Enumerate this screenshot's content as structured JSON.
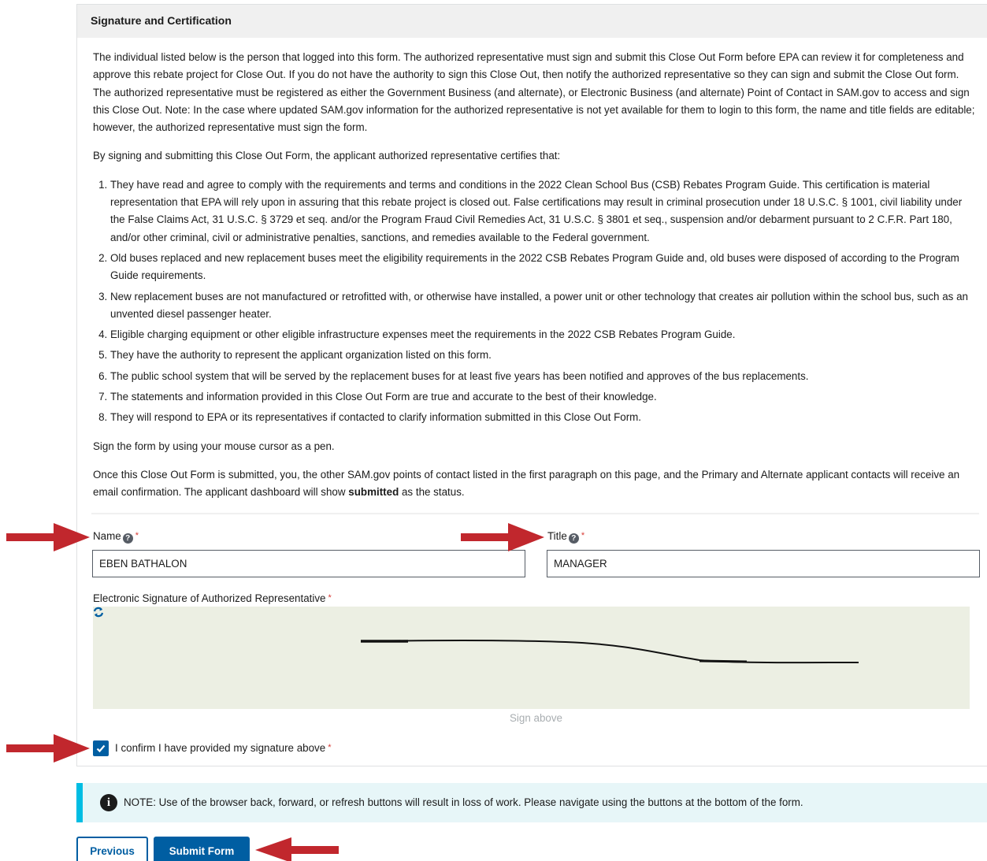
{
  "panel": {
    "title": "Signature and Certification",
    "intro": "The individual listed below is the person that logged into this form. The authorized representative must sign and submit this Close Out Form before EPA can review it for completeness and approve this rebate project for Close Out. If you do not have the authority to sign this Close Out, then notify the authorized representative so they can sign and submit the Close Out form. The authorized representative must be registered as either the Government Business (and alternate), or Electronic Business (and alternate) Point of Contact in SAM.gov to access and sign this Close Out. Note: In the case where updated SAM.gov information for the authorized representative is not yet available for them to login to this form, the name and title fields are editable; however, the authorized representative must sign the form.",
    "certify_lead": "By signing and submitting this Close Out Form, the applicant authorized representative certifies that:",
    "certifications": [
      "They have read and agree to comply with the requirements and terms and conditions in the 2022 Clean School Bus (CSB) Rebates Program Guide. This certification is material representation that EPA will rely upon in assuring that this rebate project is closed out. False certifications may result in criminal prosecution under 18 U.S.C. § 1001, civil liability under the False Claims Act, 31 U.S.C. § 3729 et seq. and/or the Program Fraud Civil Remedies Act, 31 U.S.C. § 3801 et seq., suspension and/or debarment pursuant to 2 C.F.R. Part 180, and/or other criminal, civil or administrative penalties, sanctions, and remedies available to the Federal government.",
      "Old buses replaced and new replacement buses meet the eligibility requirements in the 2022 CSB Rebates Program Guide and, old buses were disposed of according to the Program Guide requirements.",
      "New replacement buses are not manufactured or retrofitted with, or otherwise have installed, a power unit or other technology that creates air pollution within the school bus, such as an unvented diesel passenger heater.",
      "Eligible charging equipment or other eligible infrastructure expenses meet the requirements in the 2022 CSB Rebates Program Guide.",
      "They have the authority to represent the applicant organization listed on this form.",
      "The public school system that will be served by the replacement buses for at least five years has been notified and approves of the bus replacements.",
      "The statements and information provided in this Close Out Form are true and accurate to the best of their knowledge.",
      "They will respond to EPA or its representatives if contacted to clarify information submitted in this Close Out Form."
    ],
    "sign_instruction": "Sign the form by using your mouse cursor as a pen.",
    "confirm_text_a": "Once this Close Out Form is submitted, you, the other SAM.gov points of contact listed in the first paragraph on this page, and the Primary and Alternate applicant contacts will receive an email confirmation. The applicant dashboard will show ",
    "confirm_text_bold": "submitted",
    "confirm_text_b": " as the status."
  },
  "fields": {
    "name_label": "Name",
    "name_value": "EBEN BATHALON",
    "title_label": "Title",
    "title_value": "MANAGER",
    "help_glyph": "?",
    "required_mark": "*",
    "signature_label": "Electronic Signature of Authorized Representative",
    "signature_hint": "Sign above",
    "confirm_checkbox_label": "I confirm I have provided my signature above",
    "confirm_checked": true
  },
  "note": {
    "icon_glyph": "i",
    "text": "NOTE: Use of the browser back, forward, or refresh buttons will result in loss of work. Please navigate using the buttons at the bottom of the form."
  },
  "buttons": {
    "previous": "Previous",
    "submit": "Submit Form"
  },
  "colors": {
    "primary": "#005ea2",
    "annotation_arrow": "#c1272d",
    "signature_bg": "#ecefe3",
    "note_bg": "#e7f6f8",
    "note_accent": "#00bde3"
  }
}
